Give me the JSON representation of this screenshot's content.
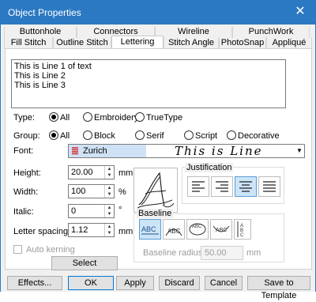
{
  "window": {
    "title": "Object Properties",
    "close_icon": "close-icon"
  },
  "tabs_row1": [
    "Buttonhole",
    "Connectors",
    "Wireline",
    "PunchWork"
  ],
  "tabs_row2": [
    "Fill Stitch",
    "Outline Stitch",
    "Lettering",
    "Stitch Angle",
    "PhotoSnap",
    "Appliqué"
  ],
  "active_tab": "Lettering",
  "text": {
    "lines": [
      "This is Line 1 of text",
      "This is Line 2",
      "This is Line 3"
    ]
  },
  "type": {
    "label": "Type:",
    "options": [
      "All",
      "Embroidery",
      "TrueType"
    ],
    "selected": "All"
  },
  "group": {
    "label": "Group:",
    "options": [
      "All",
      "Block",
      "Serif",
      "Script",
      "Decorative"
    ],
    "selected": "All"
  },
  "font": {
    "label": "Font:",
    "value": "Zurich",
    "preview": "This is Line",
    "icon": "embroidery-font-icon"
  },
  "height": {
    "label": "Height:",
    "value": "20.00",
    "unit": "mm"
  },
  "width": {
    "label": "Width:",
    "value": "100",
    "unit": "%"
  },
  "italic": {
    "label": "Italic:",
    "value": "0",
    "unit": "°"
  },
  "letter_spacing": {
    "label": "Letter spacing:",
    "value": "1.12",
    "unit": "mm"
  },
  "auto_kerning": {
    "label": "Auto kerning",
    "checked": false,
    "enabled": false
  },
  "select_character": "Select Character...",
  "justification": {
    "label": "Justification",
    "options": [
      "left",
      "right",
      "center",
      "full"
    ],
    "selected": "center"
  },
  "baseline": {
    "label": "Baseline",
    "options": [
      "straight",
      "arc-top",
      "circle",
      "arc-bottom",
      "vertical"
    ],
    "selected": "straight",
    "radius_label": "Baseline radius:",
    "radius_value": "50.00",
    "radius_unit": "mm"
  },
  "buttons": {
    "effects": "Effects...",
    "ok": "OK",
    "apply": "Apply",
    "discard": "Discard",
    "cancel": "Cancel",
    "save_template": "Save to Template"
  }
}
